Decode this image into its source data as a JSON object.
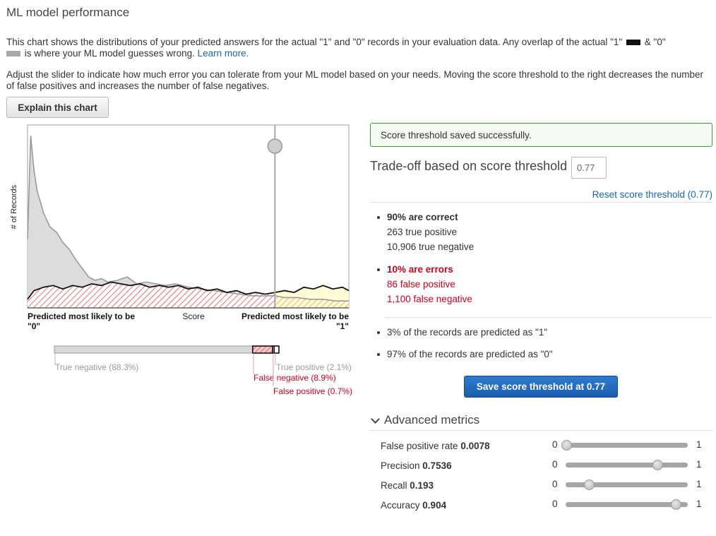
{
  "page": {
    "title": "ML model performance",
    "intro_part1": "This chart shows the distributions of your predicted answers for the actual \"1\" and \"0\" records in your evaluation data. Any overlap of the actual \"1\"",
    "intro_amp": "& \"0\"",
    "intro_part2": "is where your ML model guesses wrong.",
    "learn_more": "Learn more.",
    "adjust_text": "Adjust the slider to indicate how much error you can tolerate from your ML model based on your needs. Moving the score threshold to the right decreases the number of false positives and increases the number of false negatives.",
    "explain_button": "Explain this chart"
  },
  "chart_data": {
    "type": "area",
    "ylabel": "# of Records",
    "xlabel": "Score",
    "x_left_label_line1": "Predicted most likely to be",
    "x_left_label_line2": "\"0\"",
    "x_right_label_line1": "Predicted most likely to be",
    "x_right_label_line2": "\"1\"",
    "xlim": [
      0,
      1
    ],
    "threshold": 0.77,
    "series": [
      {
        "name": "Actual \"0\"",
        "x": [
          0.0,
          0.01,
          0.02,
          0.03,
          0.05,
          0.07,
          0.09,
          0.11,
          0.13,
          0.15,
          0.17,
          0.19,
          0.21,
          0.23,
          0.25,
          0.28,
          0.31,
          0.34,
          0.37,
          0.4,
          0.43,
          0.46,
          0.5,
          0.54,
          0.58,
          0.62,
          0.66,
          0.7,
          0.74,
          0.77,
          0.8,
          0.84,
          0.88,
          0.92,
          0.96,
          1.0
        ],
        "values": [
          40,
          100,
          80,
          68,
          55,
          47,
          44,
          38,
          34,
          28,
          23,
          18,
          16,
          17,
          15,
          16,
          18,
          14,
          15,
          14,
          13,
          14,
          12,
          11,
          10,
          9,
          8,
          7,
          7,
          7,
          6,
          6,
          5,
          5,
          4,
          4
        ]
      },
      {
        "name": "Actual \"1\"",
        "x": [
          0.0,
          0.02,
          0.05,
          0.08,
          0.11,
          0.14,
          0.17,
          0.2,
          0.23,
          0.26,
          0.29,
          0.32,
          0.35,
          0.38,
          0.41,
          0.44,
          0.47,
          0.5,
          0.53,
          0.56,
          0.59,
          0.62,
          0.65,
          0.68,
          0.71,
          0.74,
          0.77,
          0.8,
          0.83,
          0.86,
          0.89,
          0.92,
          0.95,
          0.98,
          1.0
        ],
        "values": [
          5,
          10,
          12,
          13,
          11,
          13,
          12,
          14,
          13,
          15,
          14,
          13,
          14,
          12,
          13,
          12,
          13,
          11,
          12,
          10,
          11,
          9,
          10,
          8,
          9,
          8,
          9,
          10,
          9,
          12,
          11,
          13,
          11,
          12,
          10
        ]
      }
    ]
  },
  "distribution_bar": {
    "true_negative": "True negative (88.3%)",
    "false_negative": "False negative (8.9%)",
    "true_positive": "True positive (2.1%)",
    "false_positive": "False positive (0.7%)",
    "fractions": {
      "true_negative": 0.883,
      "false_negative": 0.089,
      "false_positive": 0.007,
      "true_positive": 0.021
    }
  },
  "alert": {
    "text": "Score threshold saved successfully."
  },
  "tradeoff": {
    "label": "Trade-off based on score threshold",
    "input_value": "0.77",
    "reset_link": "Reset score threshold (0.77)"
  },
  "stats": {
    "correct_title": "90% are correct",
    "true_positive": "263 true positive",
    "true_negative": "10,906 true negative",
    "errors_title": "10% are errors",
    "false_positive": "86 false positive",
    "false_negative": "1,100 false negative",
    "predicted_1": "3% of the records are predicted as \"1\"",
    "predicted_0": "97% of the records are predicted as \"0\""
  },
  "save_button": "Save score threshold at 0.77",
  "advanced": {
    "title": "Advanced metrics",
    "metrics": [
      {
        "label": "False positive rate",
        "value": "0.0078",
        "min": "0",
        "max": "1",
        "level": 0.0078
      },
      {
        "label": "Precision",
        "value": "0.7536",
        "min": "0",
        "max": "1",
        "level": 0.7536
      },
      {
        "label": "Recall",
        "value": "0.193",
        "min": "0",
        "max": "1",
        "level": 0.193
      },
      {
        "label": "Accuracy",
        "value": "0.904",
        "min": "0",
        "max": "1",
        "level": 0.904
      }
    ]
  },
  "colors": {
    "link": "#1a66b5",
    "error_red": "#d0021b",
    "success_border": "#3e9a3a",
    "primary_button": "#1f67b8",
    "fn_hatch": "#e05050",
    "fp_fill": "#fffbd6"
  }
}
